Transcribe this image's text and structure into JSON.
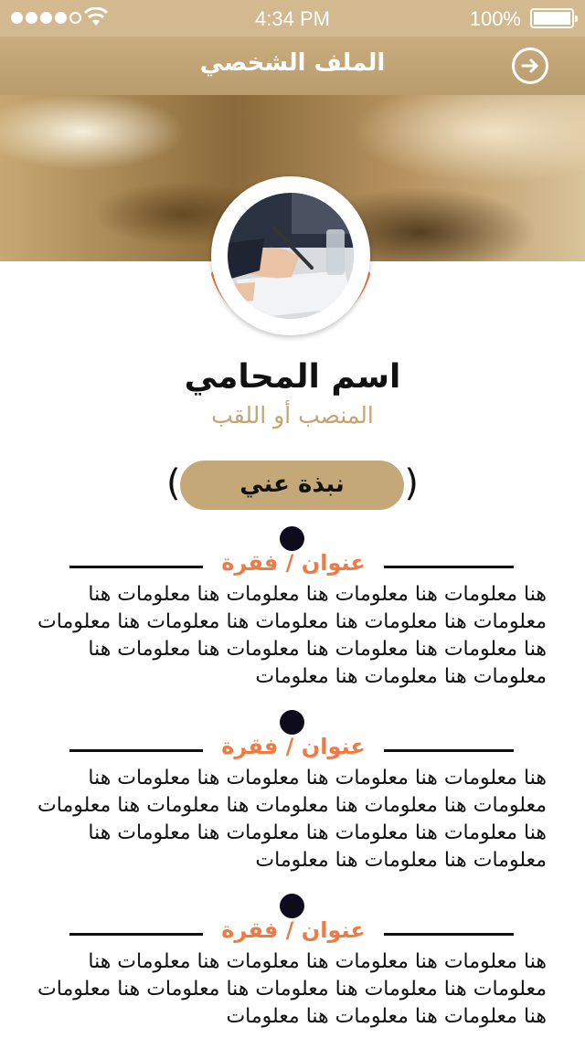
{
  "status_bar": {
    "time": "4:34 PM",
    "battery": "100%",
    "signal_bars": 4,
    "signal_total": 5
  },
  "header": {
    "title": "الملف الشخصي",
    "action_icon": "arrow-right-circle-icon"
  },
  "profile": {
    "name": "اسم المحامي",
    "role": "المنصب أو اللقب",
    "photo_icon": "lawyer-photo",
    "accent_color": "#ee7a45",
    "brand_color": "#c5a878"
  },
  "about": {
    "label": "نبذة عني",
    "open_paren": "(",
    "close_paren": ")"
  },
  "sections": [
    {
      "title": "عنوان / فقرة",
      "body": "هنا معلومات هنا معلومات هنا معلومات هنا معلومات هنا معلومات هنا معلومات هنا معلومات هنا معلومات هنا معلومات هنا معلومات هنا معلومات هنا معلومات هنا معلومات هنا معلومات هنا معلومات هنا معلومات"
    },
    {
      "title": "عنوان / فقرة",
      "body": "هنا معلومات هنا معلومات هنا معلومات هنا معلومات هنا معلومات هنا معلومات هنا معلومات هنا معلومات هنا معلومات هنا معلومات هنا معلومات هنا معلومات هنا معلومات هنا معلومات هنا معلومات هنا معلومات"
    },
    {
      "title": "عنوان / فقرة",
      "body": "هنا معلومات هنا معلومات هنا معلومات هنا معلومات هنا معلومات هنا معلومات هنا معلومات هنا معلومات هنا معلومات هنا معلومات هنا معلومات هنا معلومات"
    }
  ]
}
